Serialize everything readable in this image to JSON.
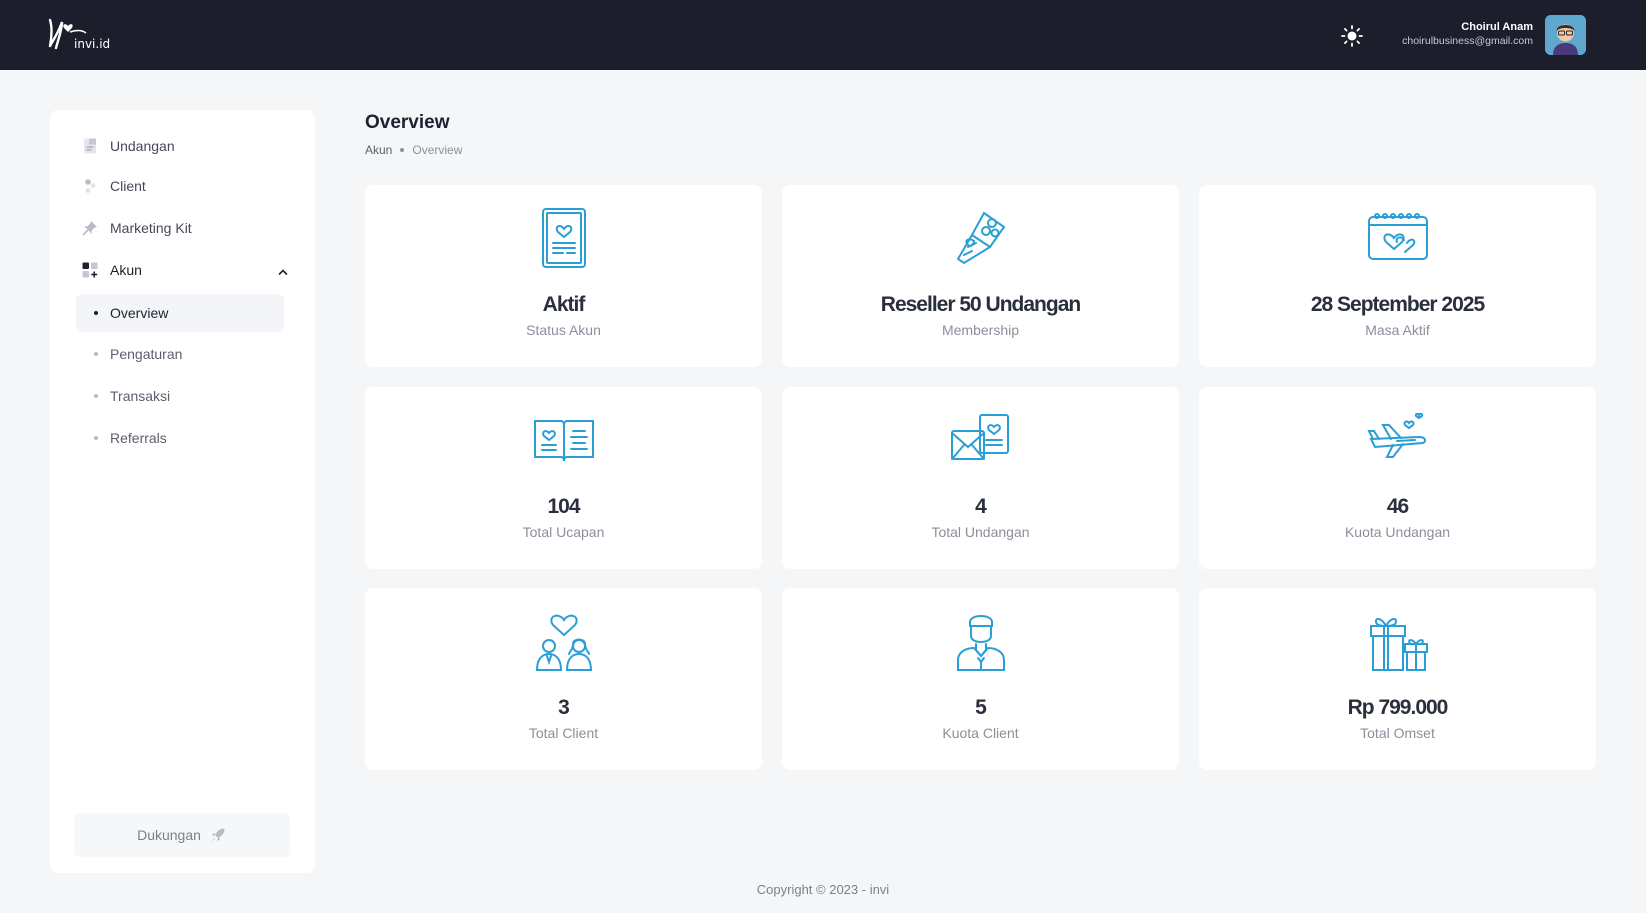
{
  "header": {
    "logo_text": "invi.id",
    "user_name": "Choirul Anam",
    "user_email": "choirulbusiness@gmail.com"
  },
  "sidebar": {
    "items": [
      {
        "label": "Undangan",
        "icon": "invitation-doc-icon"
      },
      {
        "label": "Client",
        "icon": "client-users-icon"
      },
      {
        "label": "Marketing Kit",
        "icon": "pin-icon"
      },
      {
        "label": "Akun",
        "icon": "grid-account-icon",
        "expanded": true
      }
    ],
    "subitems": [
      {
        "label": "Overview",
        "active": true
      },
      {
        "label": "Pengaturan",
        "active": false
      },
      {
        "label": "Transaksi",
        "active": false
      },
      {
        "label": "Referrals",
        "active": false
      }
    ],
    "support_label": "Dukungan"
  },
  "page": {
    "title": "Overview",
    "breadcrumb_root": "Akun",
    "breadcrumb_current": "Overview"
  },
  "cards": [
    {
      "value": "Aktif",
      "caption": "Status Akun",
      "icon": "certificate-icon"
    },
    {
      "value": "Reseller 50 Undangan",
      "caption": "Membership",
      "icon": "bouquet-icon"
    },
    {
      "value": "28 September 2025",
      "caption": "Masa Aktif",
      "icon": "calendar-heart-icon"
    },
    {
      "value": "104",
      "caption": "Total Ucapan",
      "icon": "open-book-icon"
    },
    {
      "value": "4",
      "caption": "Total Undangan",
      "icon": "envelope-card-icon"
    },
    {
      "value": "46",
      "caption": "Kuota Undangan",
      "icon": "airplane-icon"
    },
    {
      "value": "3",
      "caption": "Total Client",
      "icon": "couple-icon"
    },
    {
      "value": "5",
      "caption": "Kuota Client",
      "icon": "groom-icon"
    },
    {
      "value": "Rp 799.000",
      "caption": "Total Omset",
      "icon": "gift-icon"
    }
  ],
  "footer": {
    "copyright": "Copyright © 2023 - invi"
  },
  "colors": {
    "header_bg": "#1c1e2c",
    "accent_icon": "#2a9fd6",
    "page_bg": "#f5f6f8"
  }
}
